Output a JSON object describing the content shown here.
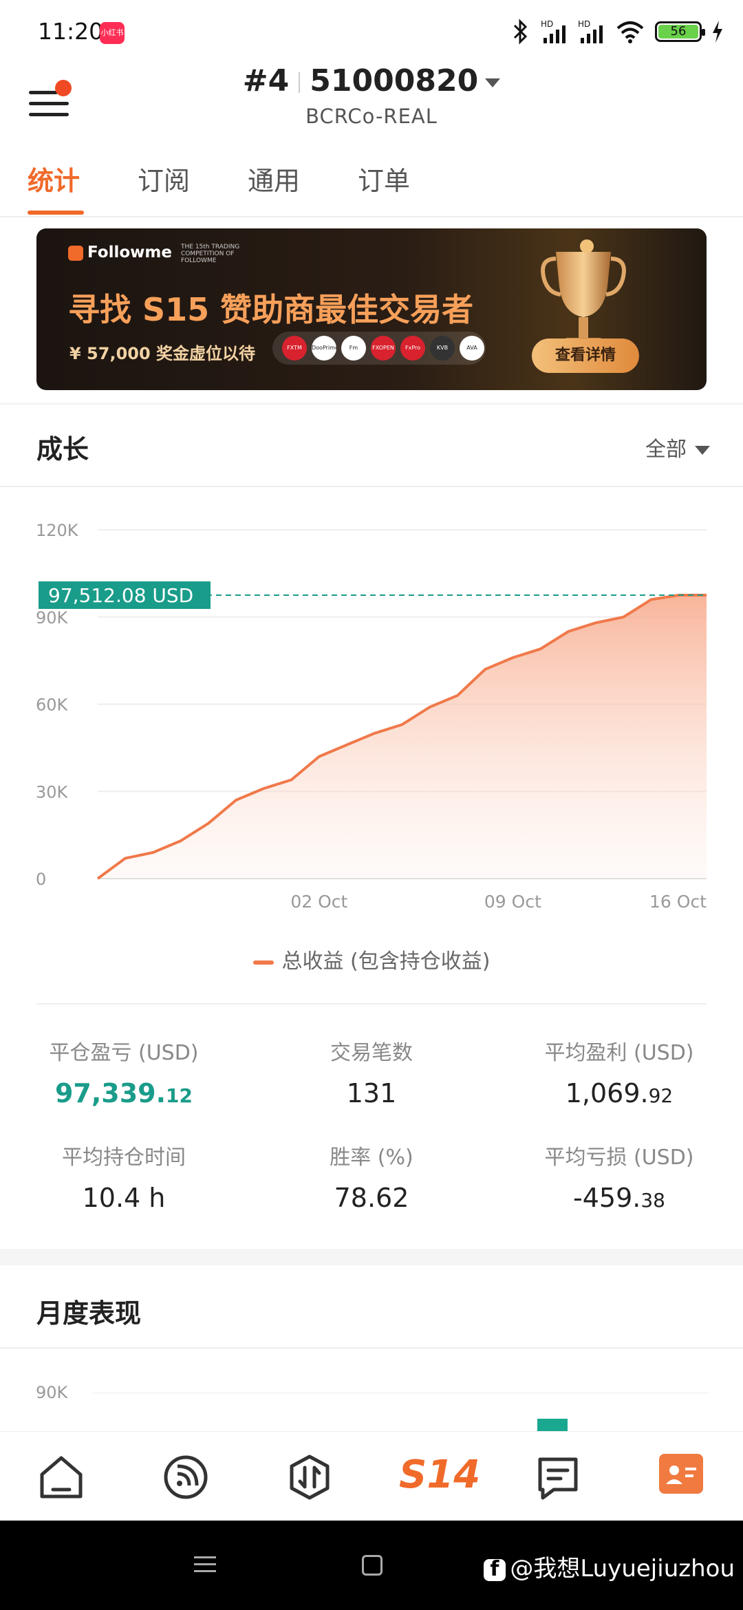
{
  "status": {
    "time": "11:20",
    "app_badge": "小红书",
    "battery": "56",
    "net1": "HD",
    "net2": "HD"
  },
  "header": {
    "rank": "#4",
    "account": "51000820",
    "server": "BCRCo-REAL"
  },
  "tabs": [
    {
      "label": "统计",
      "active": true
    },
    {
      "label": "订阅",
      "active": false
    },
    {
      "label": "通用",
      "active": false
    },
    {
      "label": "订单",
      "active": false
    }
  ],
  "banner": {
    "brand": "Followme",
    "competition": "THE 15th TRADING COMPETITION OF FOLLOWME",
    "title": "寻找 S15 赞助商最佳交易者",
    "prize": "¥ 57,000 奖金虚位以待",
    "sponsors": [
      "FXTM",
      "DooPrime",
      "Fm",
      "FXOPEN",
      "FxPro",
      "KVB",
      "AVA"
    ],
    "button": "查看详情"
  },
  "growth": {
    "title": "成长",
    "filter": "全部"
  },
  "chart_data": {
    "type": "area",
    "title": "",
    "xlabel": "",
    "ylabel": "",
    "ylim": [
      0,
      120000
    ],
    "yticks": [
      "0",
      "30K",
      "60K",
      "90K",
      "120K"
    ],
    "xticks": [
      "02 Oct",
      "09 Oct",
      "16 Oct"
    ],
    "x": [
      0,
      1,
      2,
      3,
      4,
      5,
      6,
      7,
      8,
      9,
      10,
      11,
      12,
      13,
      14,
      15,
      16,
      17,
      18,
      19,
      20,
      21,
      22
    ],
    "series": [
      {
        "name": "总收益 (包含持仓收益)",
        "values": [
          0,
          7000,
          9000,
          13000,
          19000,
          27000,
          31000,
          34000,
          42000,
          46000,
          50000,
          53000,
          59000,
          63000,
          72000,
          76000,
          79000,
          85000,
          88000,
          90000,
          96000,
          97512,
          97512
        ]
      }
    ],
    "current_value_label": "97,512.08 USD",
    "current_value": 97512.08,
    "legend": "总收益 (包含持仓收益)",
    "line_color": "#f0794a",
    "reference_line_color": "#1a9c8a"
  },
  "stats": [
    {
      "label": "平仓盈亏 (USD)",
      "int": "97,339.",
      "dec": "12",
      "green": true
    },
    {
      "label": "交易笔数",
      "int": "131",
      "dec": "",
      "green": false
    },
    {
      "label": "平均盈利 (USD)",
      "int": "1,069.",
      "dec": "92",
      "green": false
    },
    {
      "label": "平均持仓时间",
      "int": "10.4 h",
      "dec": "",
      "green": false
    },
    {
      "label": "胜率 (%)",
      "int": "78.62",
      "dec": "",
      "green": false
    },
    {
      "label": "平均亏损 (USD)",
      "int": "-459.",
      "dec": "38",
      "green": false
    }
  ],
  "monthly": {
    "title": "月度表现",
    "y_tick": "90K"
  },
  "nav": {
    "s14_label": "S14"
  },
  "watermark": "@我想Luyuejiuzhou",
  "colors": {
    "accent": "#f06a2a",
    "green": "#1a9c8a",
    "chart_fill": "#f9c2a7"
  }
}
